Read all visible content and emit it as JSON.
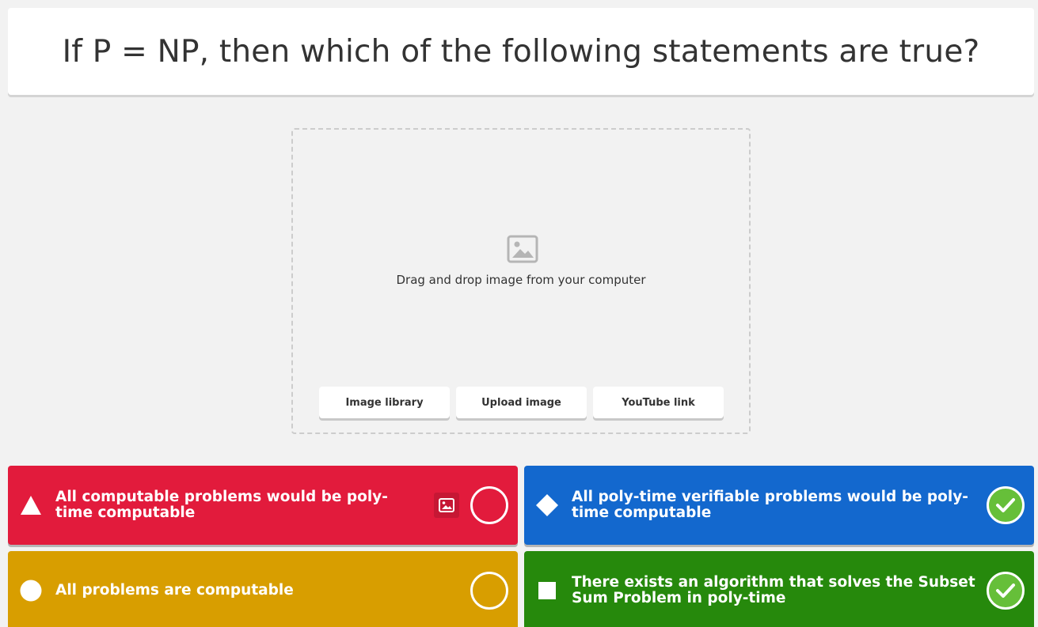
{
  "question": {
    "text": "If P = NP, then which of the following statements are true?"
  },
  "media": {
    "icon": "image-icon",
    "hint": "Drag and drop image from your computer",
    "buttons": {
      "library": "Image library",
      "upload": "Upload image",
      "youtube": "YouTube link"
    }
  },
  "answers": [
    {
      "shape": "triangle-icon",
      "color": "#e21b3c",
      "text": "All computable problems would be poly-time computable",
      "has_image_button": true,
      "correct": false
    },
    {
      "shape": "diamond-icon",
      "color": "#1368ce",
      "text": "All poly-time verifiable problems would be poly-time computable",
      "has_image_button": false,
      "correct": true
    },
    {
      "shape": "circle-icon",
      "color": "#d89e00",
      "text": "All problems are computable",
      "has_image_button": false,
      "correct": false
    },
    {
      "shape": "square-icon",
      "color": "#26890c",
      "text": "There exists an algorithm that solves the Subset Sum Problem in poly-time",
      "has_image_button": false,
      "correct": true
    }
  ],
  "colors": {
    "correct_check": "#66bf39",
    "background": "#f2f2f2"
  }
}
